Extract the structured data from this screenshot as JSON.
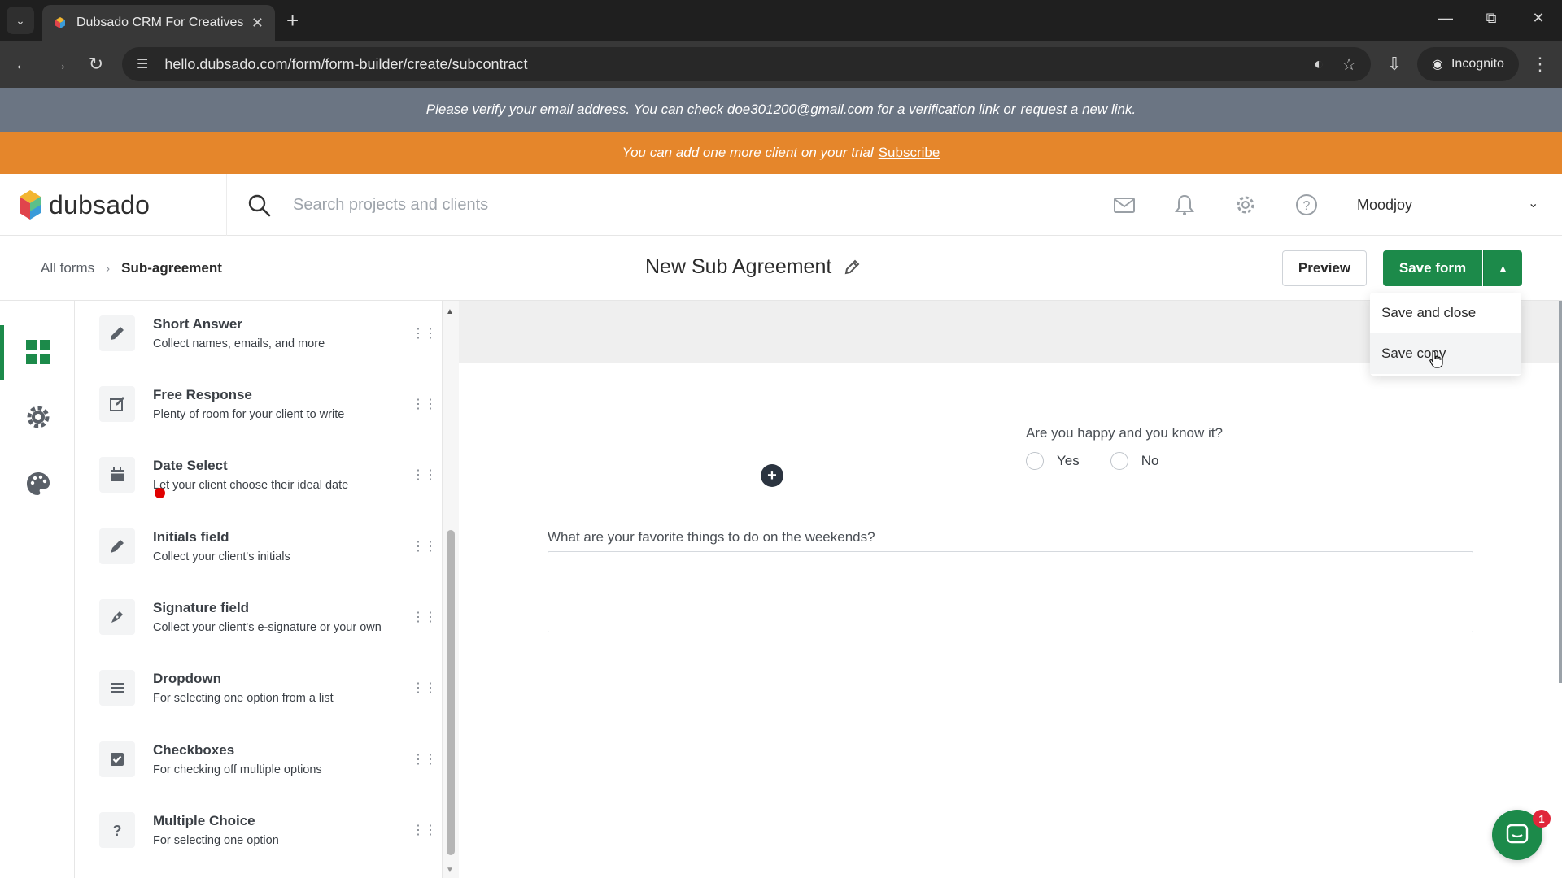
{
  "browser": {
    "tab_title": "Dubsado CRM For Creatives",
    "url": "hello.dubsado.com/form/form-builder/create/subcontract",
    "mode_label": "Incognito"
  },
  "banners": {
    "verify_text": "Please verify your email address. You can check doe301200@gmail.com for a verification link or",
    "verify_link": "request a new link.",
    "trial_text": "You can add one more client on your trial",
    "trial_link": "Subscribe"
  },
  "header": {
    "logo_text": "dubsado",
    "search_placeholder": "Search projects and clients",
    "user_name": "Moodjoy"
  },
  "toolbar": {
    "breadcrumb_root": "All forms",
    "breadcrumb_current": "Sub-agreement",
    "form_title": "New Sub Agreement",
    "preview_label": "Preview",
    "save_label": "Save form"
  },
  "save_menu": {
    "items": [
      {
        "label": "Save and close"
      },
      {
        "label": "Save copy"
      }
    ]
  },
  "elements": [
    {
      "title": "Short Answer",
      "desc": "Collect names, emails, and more",
      "icon": "pencil-icon"
    },
    {
      "title": "Free Response",
      "desc": "Plenty of room for your client to write",
      "icon": "edit-square-icon"
    },
    {
      "title": "Date Select",
      "desc": "Let your client choose their ideal date",
      "icon": "calendar-icon"
    },
    {
      "title": "Initials field",
      "desc": "Collect your client's initials",
      "icon": "pen-icon"
    },
    {
      "title": "Signature field",
      "desc": "Collect your client's e-signature or your own",
      "icon": "signature-pen-icon"
    },
    {
      "title": "Dropdown",
      "desc": "For selecting one option from a list",
      "icon": "list-icon"
    },
    {
      "title": "Checkboxes",
      "desc": "For checking off multiple options",
      "icon": "checkbox-icon"
    },
    {
      "title": "Multiple Choice",
      "desc": "For selecting one option",
      "icon": "question-icon"
    }
  ],
  "canvas": {
    "q1_label": "Are you happy and you know it?",
    "q1_options": [
      "Yes",
      "No"
    ],
    "q2_label": "What are your favorite things to do on the weekends?"
  },
  "chat": {
    "badge_count": "1"
  },
  "colors": {
    "brand_green": "#1c8a4a",
    "trial_orange": "#e5862b",
    "verify_gray": "#6b7583"
  }
}
